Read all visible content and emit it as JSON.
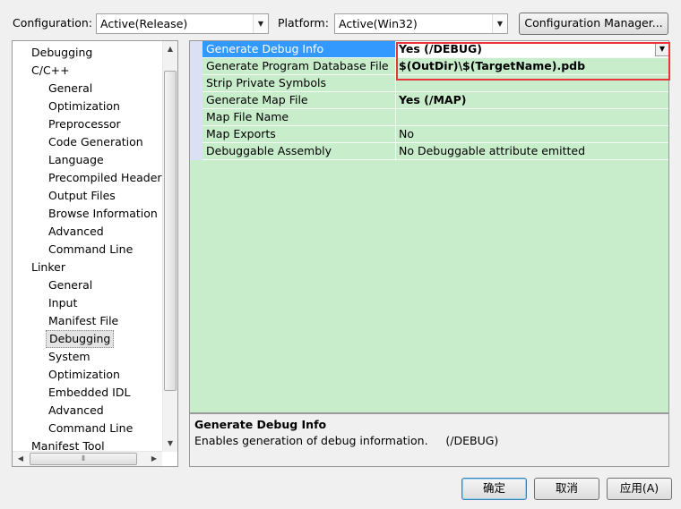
{
  "toolbar": {
    "configuration_label": "Configuration:",
    "configuration_value": "Active(Release)",
    "platform_label": "Platform:",
    "platform_value": "Active(Win32)",
    "config_manager_label": "Configuration Manager..."
  },
  "tree": {
    "items": [
      {
        "label": "Debugging",
        "level": 1
      },
      {
        "label": "C/C++",
        "level": 1
      },
      {
        "label": "General",
        "level": 2
      },
      {
        "label": "Optimization",
        "level": 2
      },
      {
        "label": "Preprocessor",
        "level": 2
      },
      {
        "label": "Code Generation",
        "level": 2
      },
      {
        "label": "Language",
        "level": 2
      },
      {
        "label": "Precompiled Headers",
        "level": 2
      },
      {
        "label": "Output Files",
        "level": 2
      },
      {
        "label": "Browse Information",
        "level": 2
      },
      {
        "label": "Advanced",
        "level": 2
      },
      {
        "label": "Command Line",
        "level": 2
      },
      {
        "label": "Linker",
        "level": 1
      },
      {
        "label": "General",
        "level": 2
      },
      {
        "label": "Input",
        "level": 2
      },
      {
        "label": "Manifest File",
        "level": 2
      },
      {
        "label": "Debugging",
        "level": 2,
        "selected": true
      },
      {
        "label": "System",
        "level": 2
      },
      {
        "label": "Optimization",
        "level": 2
      },
      {
        "label": "Embedded IDL",
        "level": 2
      },
      {
        "label": "Advanced",
        "level": 2
      },
      {
        "label": "Command Line",
        "level": 2
      },
      {
        "label": "Manifest Tool",
        "level": 1
      }
    ]
  },
  "properties": [
    {
      "name": "Generate Debug Info",
      "value": "Yes (/DEBUG)",
      "bold": true,
      "selected": true
    },
    {
      "name": "Generate Program Database File",
      "value": "$(OutDir)\\$(TargetName).pdb",
      "bold": true
    },
    {
      "name": "Strip Private Symbols",
      "value": ""
    },
    {
      "name": "Generate Map File",
      "value": "Yes (/MAP)",
      "bold": true
    },
    {
      "name": "Map File Name",
      "value": ""
    },
    {
      "name": "Map Exports",
      "value": "No"
    },
    {
      "name": "Debuggable Assembly",
      "value": "No Debuggable attribute emitted"
    }
  ],
  "description": {
    "title": "Generate Debug Info",
    "body": "Enables generation of debug information.     (/DEBUG)"
  },
  "buttons": {
    "ok": "确定",
    "cancel": "取消",
    "apply": "应用(A)"
  },
  "colors": {
    "grid_background": "#c8edcb",
    "selection": "#3399ff",
    "highlight_box": "#e8343a"
  }
}
